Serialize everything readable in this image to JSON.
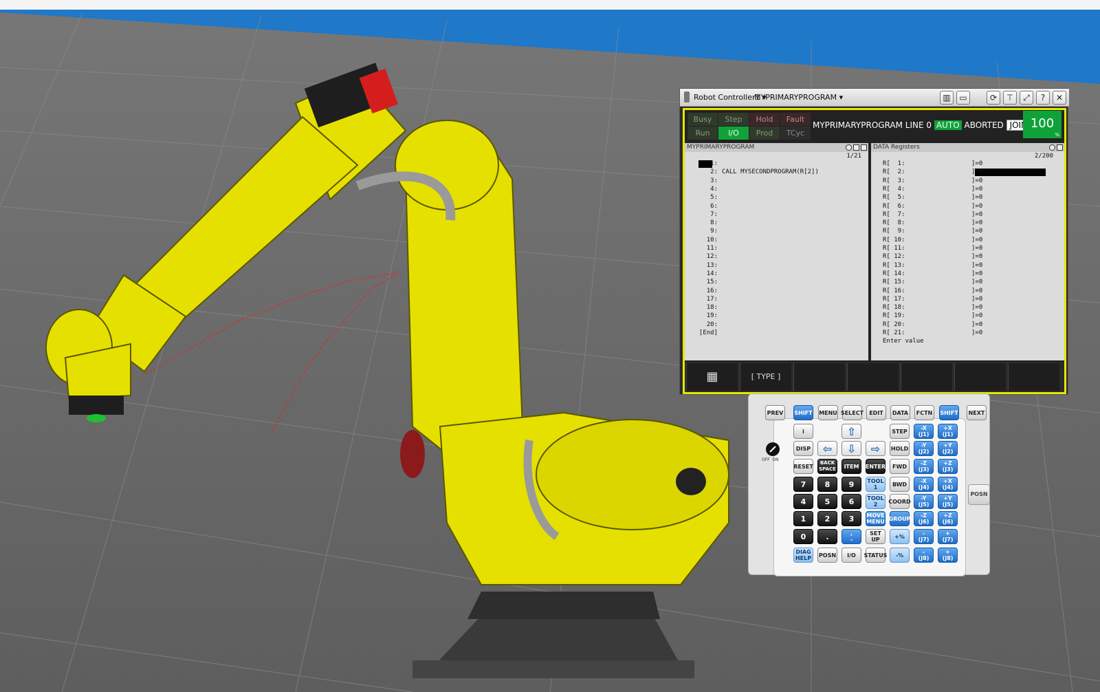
{
  "pendant": {
    "controller_label": "Robot Controller1 ▾",
    "program_selector": "MYPRIMARYPROGRAM ▾",
    "status_lights": [
      {
        "label": "Busy",
        "state": "off"
      },
      {
        "label": "Step",
        "state": "off"
      },
      {
        "label": "Hold",
        "state": "hold"
      },
      {
        "label": "Fault",
        "state": "hold"
      },
      {
        "label": "Run",
        "state": "off"
      },
      {
        "label": "I/O",
        "state": "on"
      },
      {
        "label": "Prod",
        "state": "off"
      },
      {
        "label": "TCyc",
        "state": "dim"
      }
    ],
    "status_line": {
      "program": "MYPRIMARYPROGRAM LINE 0",
      "mode": "AUTO",
      "state": "ABORTED",
      "coord": "JOINT"
    },
    "override": {
      "value": "100",
      "unit": "%"
    },
    "program_pane": {
      "title": "MYPRIMARYPROGRAM",
      "position": "1/21",
      "lines": [
        {
          "no": "1:",
          "text": ""
        },
        {
          "no": "2:",
          "text": "CALL MYSECONDPROGRAM(R[2])"
        },
        {
          "no": "3:",
          "text": ""
        },
        {
          "no": "4:",
          "text": ""
        },
        {
          "no": "5:",
          "text": ""
        },
        {
          "no": "6:",
          "text": ""
        },
        {
          "no": "7:",
          "text": ""
        },
        {
          "no": "8:",
          "text": ""
        },
        {
          "no": "9:",
          "text": ""
        },
        {
          "no": "10:",
          "text": ""
        },
        {
          "no": "11:",
          "text": ""
        },
        {
          "no": "12:",
          "text": ""
        },
        {
          "no": "13:",
          "text": ""
        },
        {
          "no": "14:",
          "text": ""
        },
        {
          "no": "15:",
          "text": ""
        },
        {
          "no": "16:",
          "text": ""
        },
        {
          "no": "17:",
          "text": ""
        },
        {
          "no": "18:",
          "text": ""
        },
        {
          "no": "19:",
          "text": ""
        },
        {
          "no": "20:",
          "text": ""
        },
        {
          "no": "[End]",
          "text": ""
        }
      ]
    },
    "register_pane": {
      "title": "DATA Registers",
      "position": "2/200",
      "registers": [
        {
          "label": "R[  1:",
          "value": "]=0"
        },
        {
          "label": "R[  2:",
          "value": "]=0"
        },
        {
          "label": "R[  3:",
          "value": "]=0"
        },
        {
          "label": "R[  4:",
          "value": "]=0"
        },
        {
          "label": "R[  5:",
          "value": "]=0"
        },
        {
          "label": "R[  6:",
          "value": "]=0"
        },
        {
          "label": "R[  7:",
          "value": "]=0"
        },
        {
          "label": "R[  8:",
          "value": "]=0"
        },
        {
          "label": "R[  9:",
          "value": "]=0"
        },
        {
          "label": "R[ 10:",
          "value": "]=0"
        },
        {
          "label": "R[ 11:",
          "value": "]=0"
        },
        {
          "label": "R[ 12:",
          "value": "]=0"
        },
        {
          "label": "R[ 13:",
          "value": "]=0"
        },
        {
          "label": "R[ 14:",
          "value": "]=0"
        },
        {
          "label": "R[ 15:",
          "value": "]=0"
        },
        {
          "label": "R[ 16:",
          "value": "]=0"
        },
        {
          "label": "R[ 17:",
          "value": "]=0"
        },
        {
          "label": "R[ 18:",
          "value": "]=0"
        },
        {
          "label": "R[ 19:",
          "value": "]=0"
        },
        {
          "label": "R[ 20:",
          "value": "]=0"
        },
        {
          "label": "R[ 21:",
          "value": "]=0"
        }
      ],
      "prompt": "Enter value"
    },
    "softkeys": [
      "",
      "[ TYPE ]",
      "",
      "",
      "",
      "",
      ""
    ]
  },
  "keypad": {
    "top_row": [
      "PREV",
      "SHIFT",
      "MENU",
      "SELECT",
      "EDIT",
      "DATA",
      "FCTN",
      "SHIFT",
      "NEXT"
    ],
    "keys": {
      "info": "i",
      "disp": "DISP",
      "reset": "RESET",
      "backspace": "BACK\nSPACE",
      "item": "ITEM",
      "enter": "ENTER",
      "step": "STEP",
      "hold": "HOLD",
      "fwd": "FWD",
      "bwd": "BWD",
      "coord": "COORD",
      "group": "GROUP",
      "tool1": "TOOL\n1",
      "tool2": "TOOL\n2",
      "move_menu": "MOVE\nMENU",
      "setup": "SET\nUP",
      "diag_help": "DIAG\nHELP",
      "posn": "POSN",
      "io": "I/O",
      "status": "STATUS",
      "speed_up": "+%",
      "speed_down": "-%",
      "n7": "7",
      "n8": "8",
      "n9": "9",
      "n4": "4",
      "n5": "5",
      "n6": "6",
      "n1": "1",
      "n2": "2",
      "n3": "3",
      "n0": "0",
      "dot": ".",
      "comma": ",\n-",
      "jog": [
        {
          "minus": "-X\n(J1)",
          "plus": "+X\n(J1)"
        },
        {
          "minus": "-Y\n(J2)",
          "plus": "+Y\n(J2)"
        },
        {
          "minus": "-Z\n(J3)",
          "plus": "+Z\n(J3)"
        },
        {
          "minus": "-X\n(J4)",
          "plus": "+X\n(J4)"
        },
        {
          "minus": "-Y\n(J5)",
          "plus": "+Y\n(J5)"
        },
        {
          "minus": "-Z\n(J6)",
          "plus": "+Z\n(J6)"
        },
        {
          "minus": "-\n(J7)",
          "plus": "+\n(J7)"
        },
        {
          "minus": "-\n(J8)",
          "plus": "+\n(J8)"
        }
      ]
    },
    "deadman_label": "OFF  ON",
    "side_posn": "POSN"
  }
}
